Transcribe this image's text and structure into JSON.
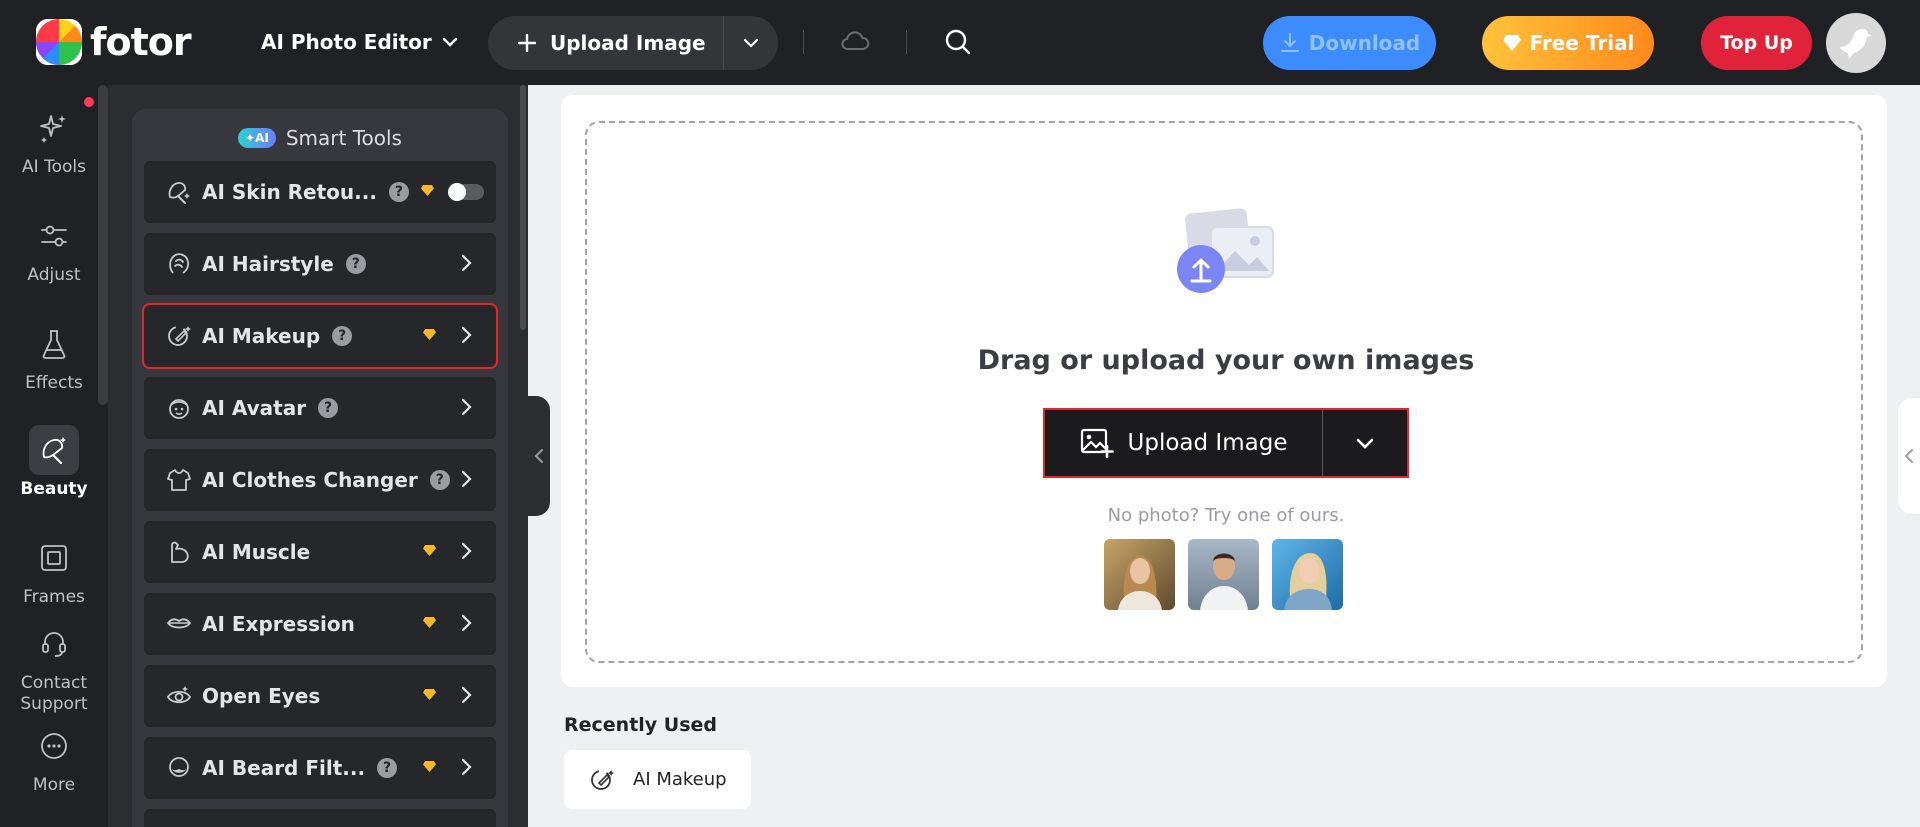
{
  "brand": {
    "name": "fotor"
  },
  "header": {
    "editor_menu": "AI Photo Editor",
    "upload_label": "Upload Image",
    "download_label": "Download",
    "trial_label": "Free Trial",
    "topup_label": "Top Up"
  },
  "rail": {
    "items": [
      {
        "label": "AI Tools"
      },
      {
        "label": "Adjust"
      },
      {
        "label": "Effects"
      },
      {
        "label": "Beauty"
      },
      {
        "label": "Frames"
      },
      {
        "label": "Contact Support"
      },
      {
        "label": "More"
      }
    ]
  },
  "panel": {
    "badge": "✦AI",
    "title": "Smart Tools",
    "tools": [
      {
        "label": "AI Skin Retou..."
      },
      {
        "label": "AI Hairstyle"
      },
      {
        "label": "AI Makeup"
      },
      {
        "label": "AI Avatar"
      },
      {
        "label": "AI Clothes Changer"
      },
      {
        "label": "AI Muscle"
      },
      {
        "label": "AI Expression"
      },
      {
        "label": "Open Eyes"
      },
      {
        "label": "AI Beard Filt..."
      }
    ],
    "help_glyph": "?"
  },
  "main": {
    "drop_title": "Drag or upload your own images",
    "upload_label": "Upload Image",
    "no_photo": "No photo? Try one of ours.",
    "recent_title": "Recently Used",
    "recent_item": "AI Makeup"
  },
  "colors": {
    "accent_red": "#e3262e",
    "download_blue": "#3c8cff",
    "topup_red": "#e0223b",
    "premium_gold": "#f5b72c"
  }
}
